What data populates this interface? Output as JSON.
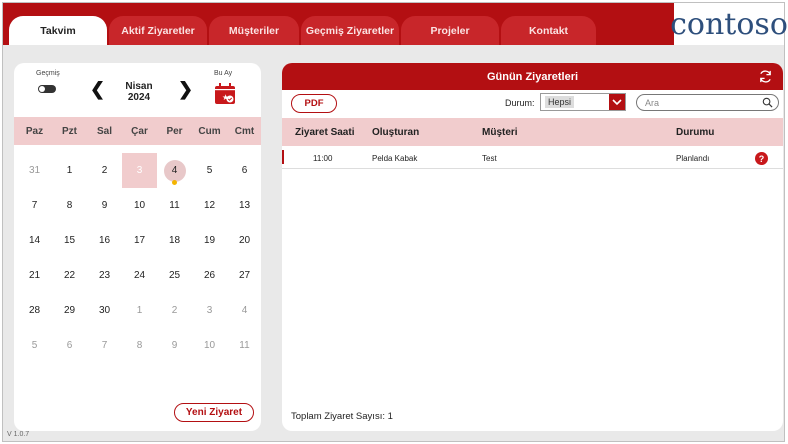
{
  "tabs": [
    {
      "label": "Takvim",
      "active": true
    },
    {
      "label": "Aktif Ziyaretler"
    },
    {
      "label": "Müşteriler"
    },
    {
      "label": "Geçmiş Ziyaretler"
    },
    {
      "label": "Projeler"
    },
    {
      "label": "Kontakt"
    }
  ],
  "logo": "contoso",
  "calendar": {
    "past_label": "Geçmiş",
    "prev_icon": "❮",
    "next_icon": "❯",
    "month": "Nisan",
    "year": "2024",
    "this_month_label": "Bu Ay",
    "weekdays": [
      "Paz",
      "Pzt",
      "Sal",
      "Çar",
      "Per",
      "Cum",
      "Cmt"
    ],
    "weeks": [
      [
        "31",
        "1",
        "2",
        "3",
        "4",
        "5",
        "6"
      ],
      [
        "7",
        "8",
        "9",
        "10",
        "11",
        "12",
        "13"
      ],
      [
        "14",
        "15",
        "16",
        "17",
        "18",
        "19",
        "20"
      ],
      [
        "21",
        "22",
        "23",
        "24",
        "25",
        "26",
        "27"
      ],
      [
        "28",
        "29",
        "30",
        "1",
        "2",
        "3",
        "4"
      ],
      [
        "5",
        "6",
        "7",
        "8",
        "9",
        "10",
        "11"
      ]
    ],
    "new_visit_label": "Yeni Ziyaret"
  },
  "visits": {
    "title": "Günün Ziyaretleri",
    "pdf_label": "PDF",
    "status_label": "Durum:",
    "status_value": "Hepsi",
    "search_placeholder": "Ara",
    "columns": [
      "Ziyaret Saati",
      "Oluşturan",
      "Müşteri",
      "Durumu"
    ],
    "rows": [
      {
        "time": "11:00",
        "creator": "Pelda Kabak",
        "customer": "Test",
        "status": "Planlandı",
        "help": "?"
      }
    ],
    "total_label": "Toplam Ziyaret Sayısı: 1"
  },
  "version": "V 1.0.7",
  "colors": {
    "accent": "#b30f12",
    "header_row": "#f1cccd",
    "logo": "#2e4f7c"
  }
}
